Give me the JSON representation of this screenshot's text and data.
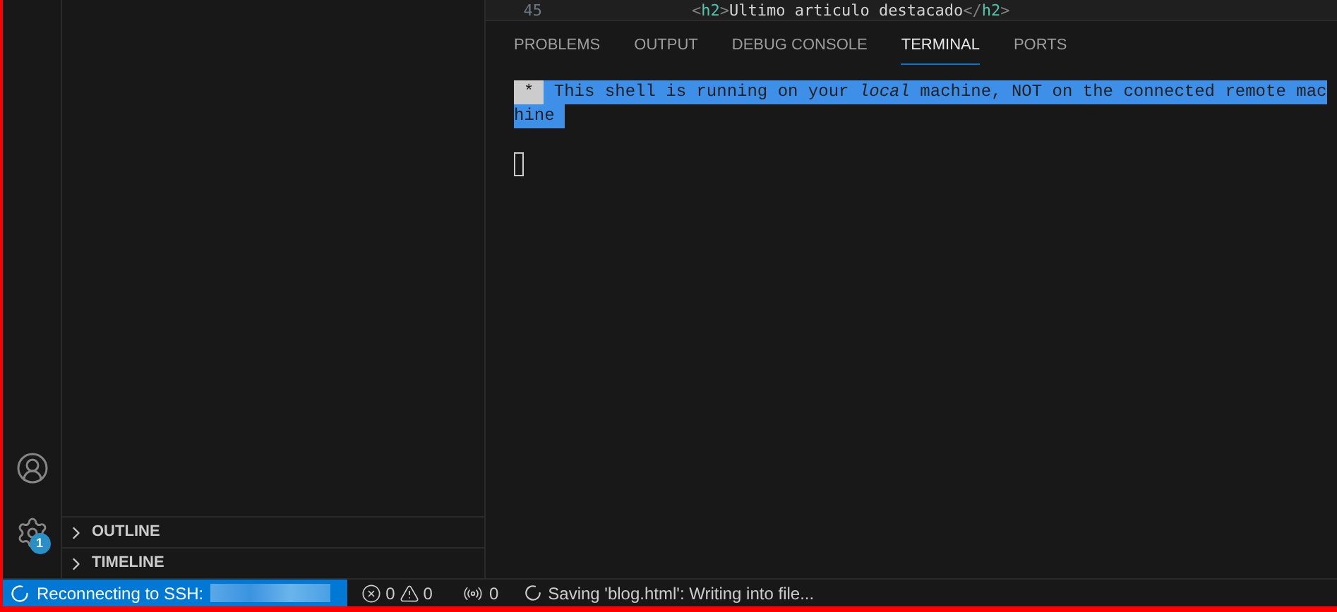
{
  "editor": {
    "line_number": "45",
    "code": [
      {
        "kind": "punct",
        "text": "<"
      },
      {
        "kind": "tag",
        "text": "h2"
      },
      {
        "kind": "punct",
        "text": ">"
      },
      {
        "kind": "text",
        "text": "Ultimo articulo destacado"
      },
      {
        "kind": "punct",
        "text": "</"
      },
      {
        "kind": "tag",
        "text": "h2"
      },
      {
        "kind": "punct",
        "text": ">"
      }
    ]
  },
  "panel": {
    "tabs": [
      {
        "label": "PROBLEMS",
        "selected": false
      },
      {
        "label": "OUTPUT",
        "selected": false
      },
      {
        "label": "DEBUG CONSOLE",
        "selected": false
      },
      {
        "label": "TERMINAL",
        "selected": true
      },
      {
        "label": "PORTS",
        "selected": false
      }
    ],
    "terminal": {
      "badge": "*",
      "lines": [
        " This shell is running on your *local* machine, NOT on the connected remote mac",
        "hine "
      ]
    }
  },
  "sidebar": {
    "sections": [
      {
        "label": "OUTLINE",
        "expanded": false
      },
      {
        "label": "TIMELINE",
        "expanded": false
      }
    ]
  },
  "activity_bar": {
    "settings_badge": "1"
  },
  "status_bar": {
    "remote": "Reconnecting to SSH:",
    "errors": "0",
    "warnings": "0",
    "ports": "0",
    "progress": "Saving 'blog.html': Writing into file..."
  }
}
